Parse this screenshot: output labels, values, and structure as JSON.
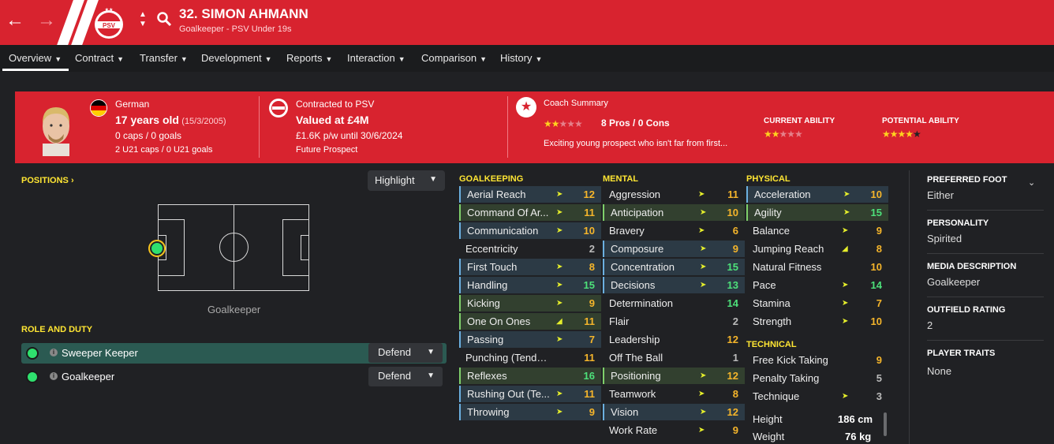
{
  "header": {
    "name": "32. SIMON AHMANN",
    "subtitle": "Goalkeeper - PSV Under 19s",
    "back_icon": "arrow-left-icon",
    "forward_icon": "arrow-right-icon",
    "club_logo": "PSV"
  },
  "tabs": [
    "Overview",
    "Contract",
    "Transfer",
    "Development",
    "Reports",
    "Interaction",
    "Comparison",
    "History"
  ],
  "info": {
    "nationality": "German",
    "age": "17 years old",
    "dob": "(15/3/2005)",
    "caps": "0 caps / 0 goals",
    "u21": "2 U21 caps / 0 U21 goals",
    "contract": "Contracted to PSV",
    "value": "Valued at £4M",
    "wage": "£1.6K p/w until 30/6/2024",
    "status": "Future Prospect",
    "coach_title": "Coach Summary",
    "pros_cons": "8 Pros / 0 Cons",
    "coach_text": "Exciting young prospect who isn't far from first...",
    "ca_label": "CURRENT ABILITY",
    "pa_label": "POTENTIAL ABILITY",
    "coach_stars": 2,
    "ca_stars": 2,
    "pa_stars": 4.5
  },
  "left": {
    "positions_label": "POSITIONS",
    "highlight": "Highlight",
    "pos_name": "Goalkeeper",
    "role_label": "ROLE AND DUTY",
    "roles": [
      {
        "name": "Sweeper Keeper",
        "duty": "Defend"
      },
      {
        "name": "Goalkeeper",
        "duty": "Defend"
      }
    ]
  },
  "attributes": {
    "goalkeeping_label": "GOALKEEPING",
    "mental_label": "MENTAL",
    "physical_label": "PHYSICAL",
    "technical_label": "TECHNICAL",
    "goalkeeping": [
      [
        "Aerial Reach",
        "12"
      ],
      [
        "Command Of Ar...",
        "11"
      ],
      [
        "Communication",
        "10"
      ],
      [
        "Eccentricity",
        "2"
      ],
      [
        "First Touch",
        "8"
      ],
      [
        "Handling",
        "15"
      ],
      [
        "Kicking",
        "9"
      ],
      [
        "One On Ones",
        "11"
      ],
      [
        "Passing",
        "7"
      ],
      [
        "Punching (Tende...",
        "11"
      ],
      [
        "Reflexes",
        "16"
      ],
      [
        "Rushing Out (Te...",
        "11"
      ],
      [
        "Throwing",
        "9"
      ]
    ],
    "mental": [
      [
        "Aggression",
        "11"
      ],
      [
        "Anticipation",
        "10"
      ],
      [
        "Bravery",
        "6"
      ],
      [
        "Composure",
        "9"
      ],
      [
        "Concentration",
        "15"
      ],
      [
        "Decisions",
        "13"
      ],
      [
        "Determination",
        "14"
      ],
      [
        "Flair",
        "2"
      ],
      [
        "Leadership",
        "12"
      ],
      [
        "Off The Ball",
        "1"
      ],
      [
        "Positioning",
        "12"
      ],
      [
        "Teamwork",
        "8"
      ],
      [
        "Vision",
        "12"
      ],
      [
        "Work Rate",
        "9"
      ]
    ],
    "physical": [
      [
        "Acceleration",
        "10"
      ],
      [
        "Agility",
        "15"
      ],
      [
        "Balance",
        "9"
      ],
      [
        "Jumping Reach",
        "8"
      ],
      [
        "Natural Fitness",
        "10"
      ],
      [
        "Pace",
        "14"
      ],
      [
        "Stamina",
        "7"
      ],
      [
        "Strength",
        "10"
      ]
    ],
    "technical": [
      [
        "Free Kick Taking",
        "9"
      ],
      [
        "Penalty Taking",
        "5"
      ],
      [
        "Technique",
        "3"
      ]
    ],
    "height_label": "Height",
    "height": "186 cm",
    "weight_label": "Weight",
    "weight": "76 kg"
  },
  "right": {
    "foot_label": "PREFERRED FOOT",
    "foot": "Either",
    "pers_label": "PERSONALITY",
    "pers": "Spirited",
    "media_label": "MEDIA DESCRIPTION",
    "media": "Goalkeeper",
    "outfield_label": "OUTFIELD RATING",
    "outfield": "2",
    "traits_label": "PLAYER TRAITS",
    "traits": "None"
  }
}
